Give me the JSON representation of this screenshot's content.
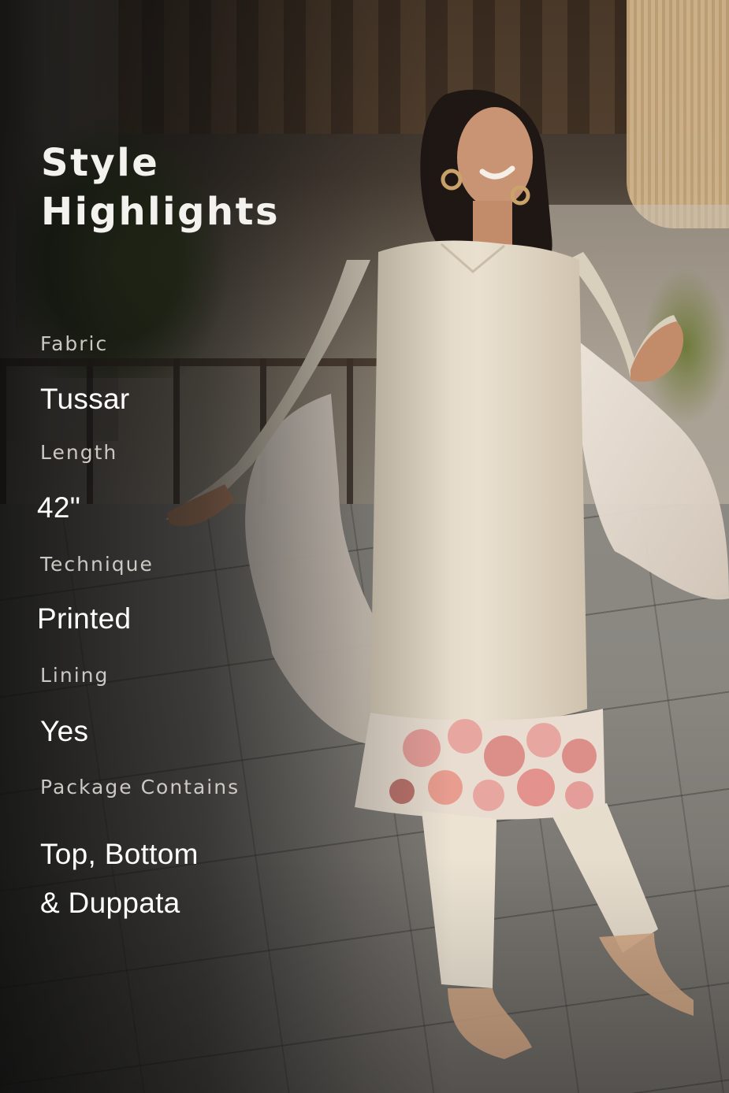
{
  "title_line1": "Style",
  "title_line2": "Highlights",
  "specs": [
    {
      "label": "Fabric",
      "value": "Tussar"
    },
    {
      "label": "Length",
      "value": "42\""
    },
    {
      "label": "Technique",
      "value": "Printed"
    },
    {
      "label": "Lining",
      "value": "Yes"
    },
    {
      "label": "Package Contains",
      "value_line1": "Top, Bottom",
      "value_line2": "& Duppata"
    }
  ],
  "colors": {
    "text_primary": "#ffffff",
    "text_label": "#d9d6d0",
    "garment": "#e6dccb",
    "print_pink": "#e38f8a"
  },
  "icons": []
}
